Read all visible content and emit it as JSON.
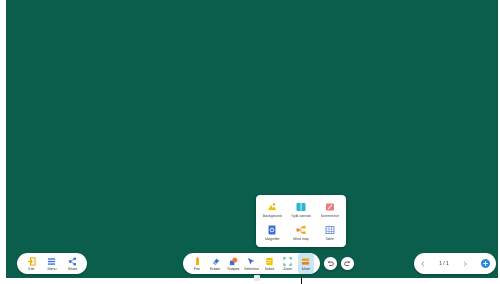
{
  "left_toolbar": {
    "items": [
      {
        "label": "Exit",
        "icon": "exit-icon"
      },
      {
        "label": "Menu",
        "icon": "menu-icon"
      },
      {
        "label": "Share",
        "icon": "share-icon"
      }
    ]
  },
  "main_toolbar": {
    "items": [
      {
        "label": "Pen",
        "icon": "pen-icon"
      },
      {
        "label": "Eraser",
        "icon": "eraser-icon"
      },
      {
        "label": "Shapes",
        "icon": "shapes-icon"
      },
      {
        "label": "Selection",
        "icon": "selection-icon"
      },
      {
        "label": "Notes",
        "icon": "notes-icon"
      },
      {
        "label": "Zoom",
        "icon": "zoom-icon"
      },
      {
        "label": "More",
        "icon": "more-icon"
      }
    ],
    "active": "More"
  },
  "more_popup": {
    "items": [
      {
        "label": "Background",
        "icon": "background-icon"
      },
      {
        "label": "Split canvas",
        "icon": "split-canvas-icon"
      },
      {
        "label": "Screenshot",
        "icon": "screenshot-icon"
      },
      {
        "label": "Magnifier",
        "icon": "magnifier-icon"
      },
      {
        "label": "Mind map",
        "icon": "mind-map-icon"
      },
      {
        "label": "Table",
        "icon": "table-icon"
      }
    ]
  },
  "pager": {
    "text": "1 / 1"
  },
  "colors": {
    "board": "#0a5e4b",
    "accent": "#1e88e5",
    "active_bg": "#c9e6f7"
  }
}
